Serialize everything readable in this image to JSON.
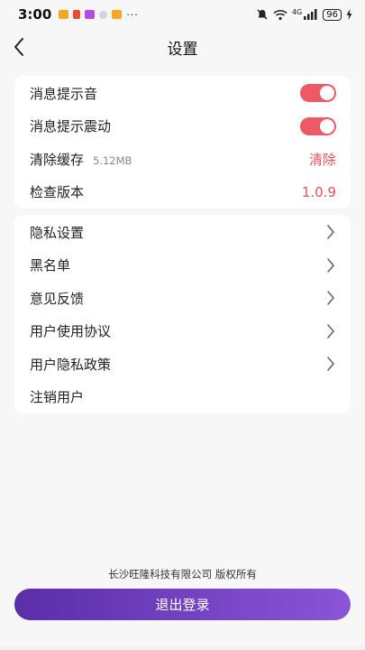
{
  "status_bar": {
    "time": "3:00",
    "dots": "···",
    "network": "4G",
    "battery": "96"
  },
  "header": {
    "title": "设置"
  },
  "settings": {
    "message_sound": {
      "label": "消息提示音",
      "enabled": true
    },
    "message_vibrate": {
      "label": "消息提示震动",
      "enabled": true
    },
    "clear_cache": {
      "label": "清除缓存",
      "size": "5.12MB",
      "action": "清除"
    },
    "check_version": {
      "label": "检查版本",
      "version": "1.0.9"
    }
  },
  "menu": [
    {
      "label": "隐私设置"
    },
    {
      "label": "黑名单"
    },
    {
      "label": "意见反馈"
    },
    {
      "label": "用户使用协议"
    },
    {
      "label": "用户隐私政策"
    },
    {
      "label": "注销用户"
    }
  ],
  "footer": {
    "copyright": "长沙旺隆科技有限公司 版权所有"
  },
  "logout": {
    "label": "退出登录"
  },
  "colors": {
    "accent_red": "#e9515c",
    "button_start": "#5a2ea8",
    "button_end": "#8a55d8"
  }
}
